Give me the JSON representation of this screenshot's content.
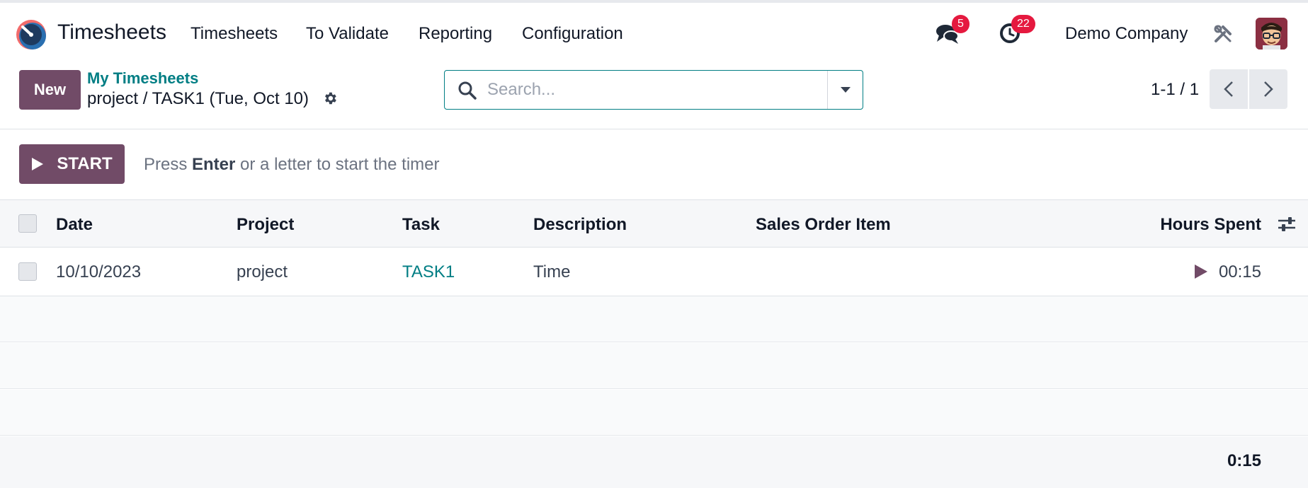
{
  "navbar": {
    "app_name": "Timesheets",
    "menu": [
      "Timesheets",
      "To Validate",
      "Reporting",
      "Configuration"
    ],
    "messages_badge": "5",
    "activities_badge": "22",
    "company": "Demo Company"
  },
  "control_panel": {
    "new_label": "New",
    "breadcrumb_link": "My Timesheets",
    "breadcrumb_current": "project / TASK1 (Tue, Oct 10)",
    "search_placeholder": "Search...",
    "pager": "1-1 / 1"
  },
  "timer": {
    "start_label": "START",
    "hint_prefix": "Press ",
    "hint_key": "Enter",
    "hint_suffix": " or a letter to start the timer"
  },
  "list": {
    "columns": [
      "Date",
      "Project",
      "Task",
      "Description",
      "Sales Order Item",
      "Hours Spent"
    ],
    "rows": [
      {
        "date": "10/10/2023",
        "project": "project",
        "task": "TASK1",
        "description": "Time",
        "sales_order_item": "",
        "hours": "00:15"
      }
    ],
    "total": "0:15"
  },
  "colors": {
    "primary": "#714b67",
    "link": "#017e84",
    "badge": "#e5193f"
  }
}
